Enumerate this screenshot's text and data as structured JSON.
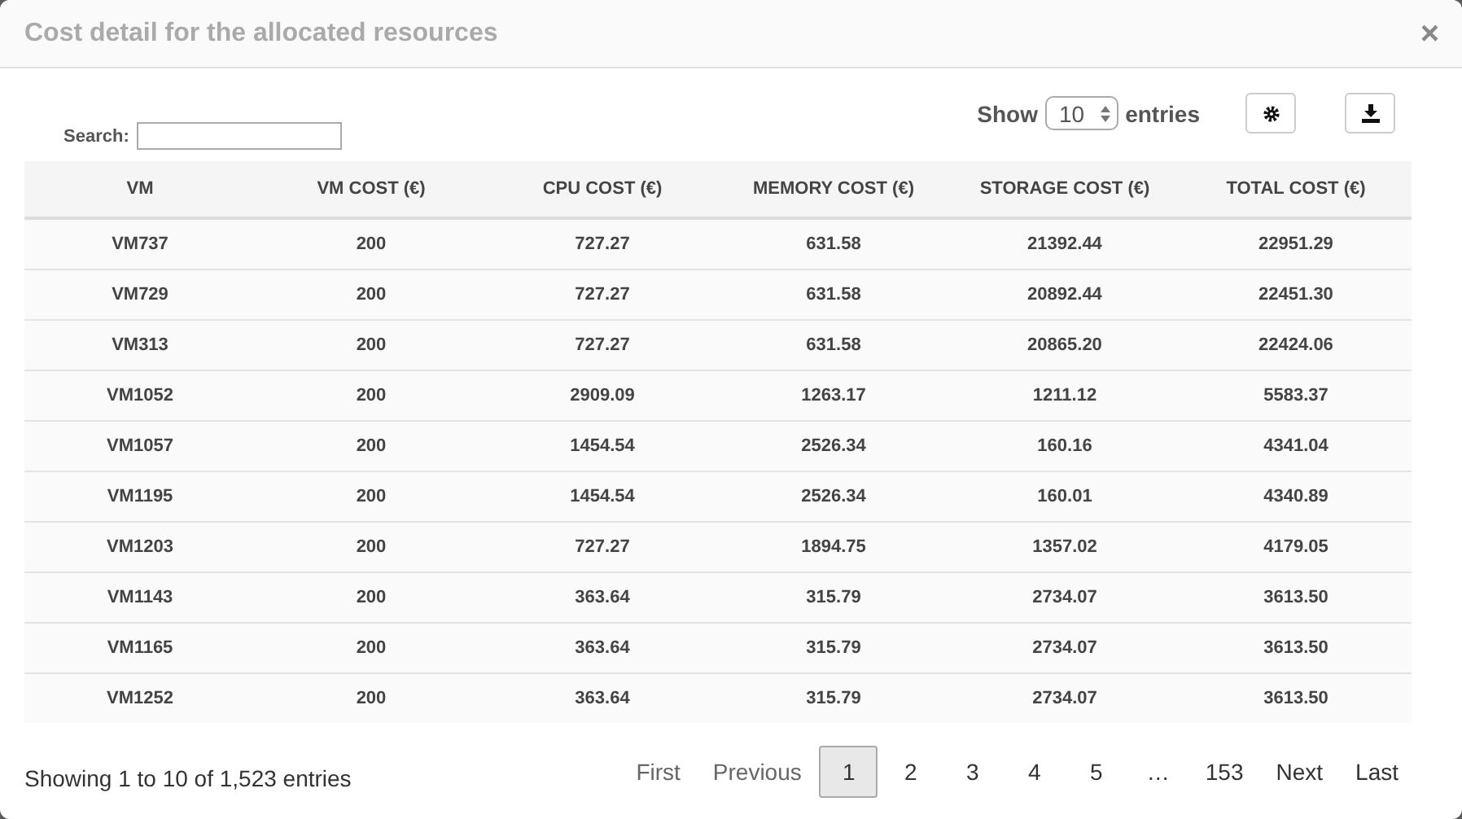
{
  "dialog": {
    "title": "Cost detail for the allocated resources",
    "close": "×"
  },
  "search": {
    "label": "Search:"
  },
  "length": {
    "before": "Show",
    "value": "10",
    "after": "entries"
  },
  "toolbar": [
    {
      "kind": "gear"
    },
    {
      "kind": "download"
    }
  ],
  "table": {
    "columns": [
      "VM",
      "VM COST (€)",
      "CPU COST (€)",
      "MEMORY COST (€)",
      "STORAGE COST (€)",
      "TOTAL COST (€)"
    ],
    "rows": [
      [
        "VM737",
        "200",
        "727.27",
        "631.58",
        "21392.44",
        "22951.29"
      ],
      [
        "VM729",
        "200",
        "727.27",
        "631.58",
        "20892.44",
        "22451.30"
      ],
      [
        "VM313",
        "200",
        "727.27",
        "631.58",
        "20865.20",
        "22424.06"
      ],
      [
        "VM1052",
        "200",
        "2909.09",
        "1263.17",
        "1211.12",
        "5583.37"
      ],
      [
        "VM1057",
        "200",
        "1454.54",
        "2526.34",
        "160.16",
        "4341.04"
      ],
      [
        "VM1195",
        "200",
        "1454.54",
        "2526.34",
        "160.01",
        "4340.89"
      ],
      [
        "VM1203",
        "200",
        "727.27",
        "1894.75",
        "1357.02",
        "4179.05"
      ],
      [
        "VM1143",
        "200",
        "363.64",
        "315.79",
        "2734.07",
        "3613.50"
      ],
      [
        "VM1165",
        "200",
        "363.64",
        "315.79",
        "2734.07",
        "3613.50"
      ],
      [
        "VM1252",
        "200",
        "363.64",
        "315.79",
        "2734.07",
        "3613.50"
      ]
    ]
  },
  "info": "Showing 1 to 10 of 1,523 entries",
  "pagination": [
    {
      "label": "First",
      "selected": false,
      "disabled": true
    },
    {
      "label": "Previous",
      "selected": false,
      "disabled": true
    },
    {
      "label": "1",
      "selected": true,
      "disabled": false
    },
    {
      "label": "2",
      "selected": false,
      "disabled": false
    },
    {
      "label": "3",
      "selected": false,
      "disabled": false
    },
    {
      "label": "4",
      "selected": false,
      "disabled": false
    },
    {
      "label": "5",
      "selected": false,
      "disabled": false
    },
    {
      "label": "…",
      "selected": false,
      "disabled": false
    },
    {
      "label": "153",
      "selected": false,
      "disabled": false
    },
    {
      "label": "Next",
      "selected": false,
      "disabled": false
    },
    {
      "label": "Last",
      "selected": false,
      "disabled": false
    }
  ]
}
